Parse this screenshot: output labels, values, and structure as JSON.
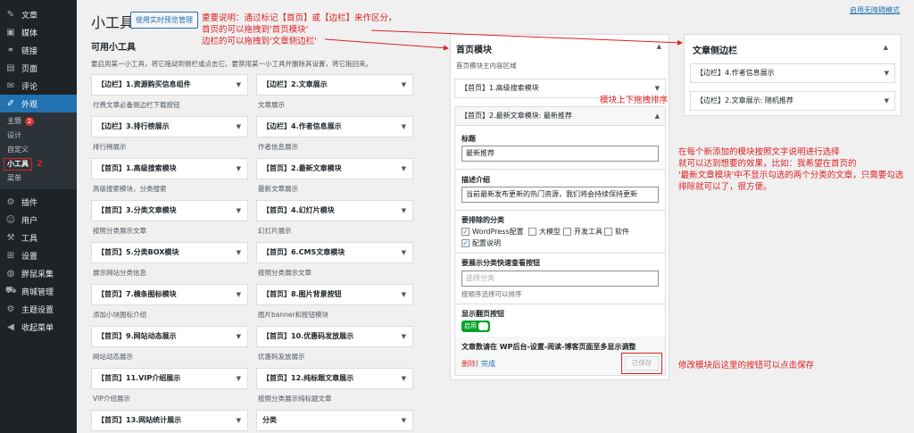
{
  "sidebar": {
    "items_top": [
      {
        "icon": "pushpin-icon",
        "glyph": "✎",
        "label": "文章"
      },
      {
        "icon": "media-icon",
        "glyph": "▣",
        "label": "媒体"
      },
      {
        "icon": "link-icon",
        "glyph": "⚭",
        "label": "链接"
      },
      {
        "icon": "page-icon",
        "glyph": "▤",
        "label": "页面"
      },
      {
        "icon": "comment-icon",
        "glyph": "✉",
        "label": "评论"
      }
    ],
    "active": {
      "icon": "appearance-icon",
      "glyph": "✐",
      "label": "外观"
    },
    "submenu": [
      {
        "label": "主题",
        "badge": "2"
      },
      {
        "label": "设计"
      },
      {
        "label": "自定义"
      },
      {
        "label": "小工具",
        "current": true,
        "annotation": "2"
      },
      {
        "label": "菜单"
      }
    ],
    "items_bottom": [
      {
        "icon": "plugin-icon",
        "glyph": "⚙",
        "label": "插件"
      },
      {
        "icon": "user-icon",
        "glyph": "☺",
        "label": "用户"
      },
      {
        "icon": "tools-icon",
        "glyph": "⚒",
        "label": "工具"
      },
      {
        "icon": "settings-icon",
        "glyph": "⊞",
        "label": "设置"
      },
      {
        "icon": "collector-icon",
        "glyph": "◍",
        "label": "胖鼠采集"
      },
      {
        "icon": "store-icon",
        "glyph": "⛟",
        "label": "商城管理"
      },
      {
        "icon": "theme-settings-icon",
        "glyph": "⚙",
        "label": "主题设置"
      },
      {
        "icon": "collapse-icon",
        "glyph": "◀",
        "label": "收起菜单"
      }
    ]
  },
  "header": {
    "title": "小工具",
    "preview_button": "使用实时预览管理",
    "accessibility_link": "启用无障碍模式"
  },
  "notes": {
    "top": [
      "重要说明：通过标记【首页】或【边栏】来作区分，",
      "首页的可以拖拽到'首页模块'",
      "边栏的可以拖拽到'文章侧边栏'"
    ],
    "reorder": "模块上下拖拽排序",
    "explain": [
      "在每个新添加的模块按照文字说明进行选择",
      "就可以达到想要的效果，比如：我希望在首页的",
      "'最新文章模块'中不显示勾选的两个分类的文章，只需要勾选",
      "排除就可以了，很方便。"
    ],
    "save": "修改模块后这里的按钮可以点击保存"
  },
  "available": {
    "title": "可用小工具",
    "desc": "要启用某一小工具，将它拖动到侧栏或点击它。要禁用某一小工具并删除其设置，将它拖回来。",
    "widgets": [
      {
        "label": "【边栏】1.资源购买信息组件",
        "desc": "付费文章必备侧边栏下载按钮"
      },
      {
        "label": "【边栏】2.文章展示",
        "desc": "文章展示"
      },
      {
        "label": "【边栏】3.排行榜展示",
        "desc": "排行榜展示"
      },
      {
        "label": "【边栏】4.作者信息展示",
        "desc": "作者信息展示"
      },
      {
        "label": "【首页】1.高级搜索模块",
        "desc": "高级搜索模块，分类搜索"
      },
      {
        "label": "【首页】2.最新文章模块",
        "desc": "最新文章展示"
      },
      {
        "label": "【首页】3.分类文章模块",
        "desc": "按照分类展示文章"
      },
      {
        "label": "【首页】4.幻灯片模块",
        "desc": "幻灯片展示"
      },
      {
        "label": "【首页】5.分类BOX模块",
        "desc": "展示网站分类信息"
      },
      {
        "label": "【首页】6.CMS文章模块",
        "desc": "按照分类展示文章"
      },
      {
        "label": "【首页】7.横条图标模块",
        "desc": "添加小块图标介绍"
      },
      {
        "label": "【首页】8.图片背景按钮",
        "desc": "图片banner和按钮模块"
      },
      {
        "label": "【首页】9.网站动态展示",
        "desc": "网站动态展示"
      },
      {
        "label": "【首页】10.优惠码发放展示",
        "desc": "优惠码发放展示"
      },
      {
        "label": "【首页】11.VIP介绍展示",
        "desc": "VIP介绍展示"
      },
      {
        "label": "【首页】12.纯标题文章展示",
        "desc": "按照分类展示纯标题文章"
      },
      {
        "label": "【首页】13.网站统计展示",
        "desc": ""
      },
      {
        "label": "分类",
        "desc": ""
      }
    ]
  },
  "home_module": {
    "title": "首页模块",
    "subtitle": "首页模块主内容区域",
    "widget1": "【首页】1.高级搜索模块",
    "widget2": "【首页】2.最新文章模块: 最新推荐",
    "title_label": "标题",
    "title_value": "最新推荐",
    "desc_label": "描述介绍",
    "desc_value": "当前最新发布更新的热门资源，我们将会持续保持更新",
    "exclude_label": "要排除的分类",
    "categories": [
      {
        "label": "WordPress配置",
        "checked": true
      },
      {
        "label": "大模型",
        "checked": false
      },
      {
        "label": "开发工具",
        "checked": false
      },
      {
        "label": "软件",
        "checked": false
      },
      {
        "label": "配置说明",
        "checked": true
      }
    ],
    "quick_label": "要展示分类快速查看按钮",
    "quick_placeholder": "选择分类",
    "quick_hint": "按顺序选择可以排序",
    "paging_label": "显示翻页按钮",
    "toggle_text": "启用",
    "count_label": "文章数请在 WP后台-设置-阅读-博客页面至多显示调整",
    "delete_link": "删除",
    "done_link": "完成",
    "saved_button": "已保存"
  },
  "article_sidebar": {
    "title": "文章侧边栏",
    "widget1": "【边栏】4.作者信息展示",
    "widget2": "【边栏】2.文章展示: 随机推荐"
  },
  "colors": {
    "accent": "#2271b1",
    "annotation": "#e02020",
    "sidebar": "#1d2327",
    "toggle": "#00a32a"
  }
}
